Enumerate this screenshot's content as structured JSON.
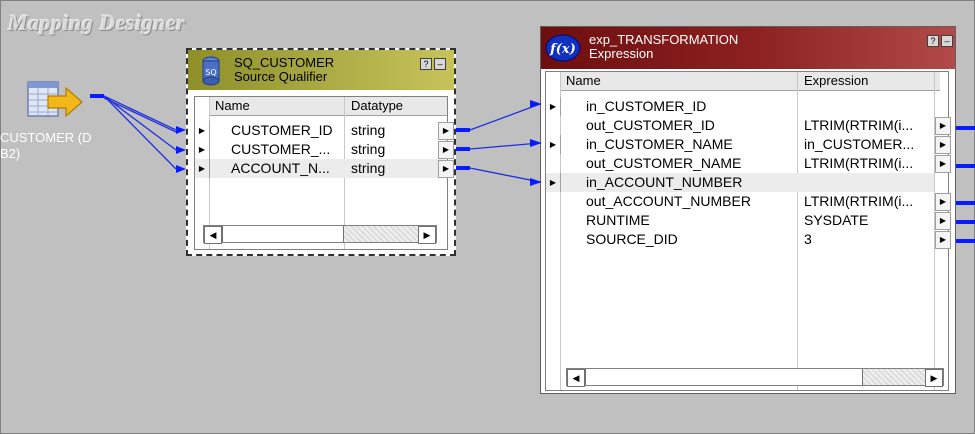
{
  "canvas": {
    "title": "Mapping Designer"
  },
  "source": {
    "label": "CUSTOMER (DB2)",
    "label_line1": "CUSTOMER (D",
    "label_line2": "B2)",
    "icon": "db-table-icon"
  },
  "source_qualifier": {
    "name": "SQ_CUSTOMER",
    "type": "Source Qualifier",
    "help_button": "?",
    "minimize_button": "–",
    "columns": [
      "Name",
      "Datatype"
    ],
    "rows": [
      {
        "name": "CUSTOMER_ID",
        "datatype": "string"
      },
      {
        "name": "CUSTOMER_...",
        "datatype": "string"
      },
      {
        "name": "ACCOUNT_N...",
        "datatype": "string"
      }
    ]
  },
  "expression": {
    "name": "exp_TRANSFORMATION",
    "type": "Expression",
    "help_button": "?",
    "minimize_button": "–",
    "columns": [
      "Name",
      "Expression"
    ],
    "rows": [
      {
        "name": "in_CUSTOMER_ID",
        "expression": ""
      },
      {
        "name": "out_CUSTOMER_ID",
        "expression": "LTRIM(RTRIM(i..."
      },
      {
        "name": "in_CUSTOMER_NAME",
        "expression": "in_CUSTOMER..."
      },
      {
        "name": "out_CUSTOMER_NAME",
        "expression": "LTRIM(RTRIM(i..."
      },
      {
        "name": "in_ACCOUNT_NUMBER",
        "expression": ""
      },
      {
        "name": "out_ACCOUNT_NUMBER",
        "expression": "LTRIM(RTRIM(i..."
      },
      {
        "name": "RUNTIME",
        "expression": "SYSDATE"
      },
      {
        "name": "SOURCE_DID",
        "expression": "3"
      }
    ]
  },
  "colors": {
    "link": "#1f2fe0",
    "port": "#0a1cff",
    "sq_header": "#a7a742",
    "exp_header": "#8c2020"
  }
}
